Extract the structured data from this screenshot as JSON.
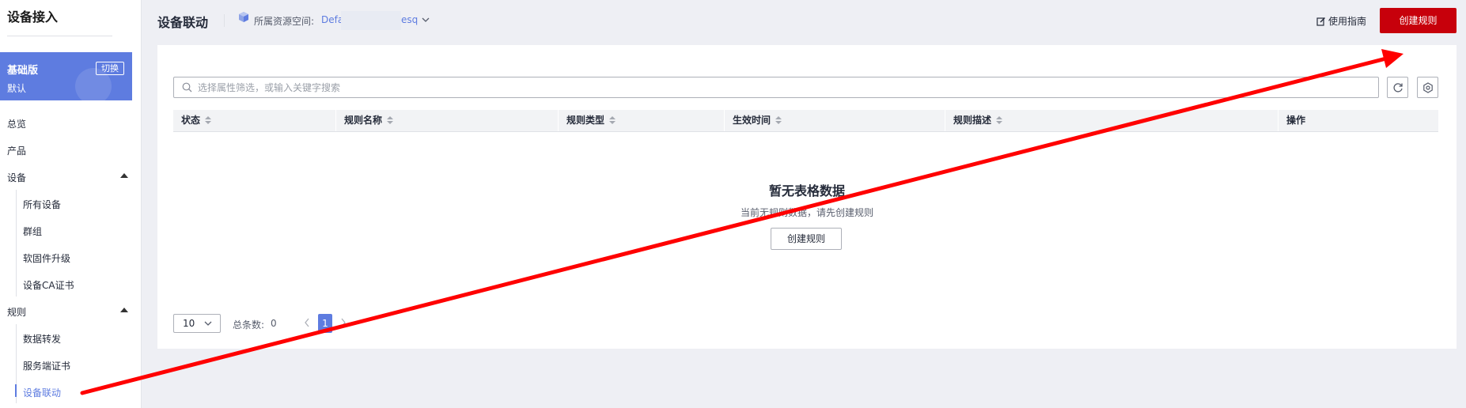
{
  "sidebar": {
    "title": "设备接入",
    "edition": {
      "name": "基础版",
      "sub": "默认",
      "switch_label": "切换"
    },
    "items": [
      {
        "label": "总览"
      },
      {
        "label": "产品"
      },
      {
        "label": "设备",
        "children": [
          "所有设备",
          "群组",
          "软固件升级",
          "设备CA证书"
        ]
      },
      {
        "label": "规则",
        "children": [
          "数据转发",
          "服务端证书",
          "设备联动"
        ]
      }
    ],
    "active_item": "设备联动"
  },
  "header": {
    "title": "设备联动",
    "space_label": "所属资源空间:",
    "space_value_start": "Defa",
    "space_value_end": "esq",
    "guide_label": "使用指南",
    "create_label": "创建规则"
  },
  "search": {
    "placeholder": "选择属性筛选，或输入关键字搜索"
  },
  "table": {
    "columns": [
      "状态",
      "规则名称",
      "规则类型",
      "生效时间",
      "规则描述",
      "操作"
    ]
  },
  "empty": {
    "title": "暂无表格数据",
    "desc": "当前无规则数据，请先创建规则",
    "button_label": "创建规则"
  },
  "pagination": {
    "page_size": "10",
    "total_label": "总条数:",
    "total_value": "0",
    "current_page": "1"
  },
  "colors": {
    "primary": "#5e7ce0",
    "danger": "#c7000b",
    "annotation_arrow": "#ff0000"
  },
  "icons": [
    "cube-icon",
    "chevron-down-icon",
    "edit-icon",
    "search-icon",
    "refresh-icon",
    "gear-icon",
    "sort-icon",
    "chevron-left-icon",
    "chevron-right-icon",
    "caret-up-icon"
  ]
}
